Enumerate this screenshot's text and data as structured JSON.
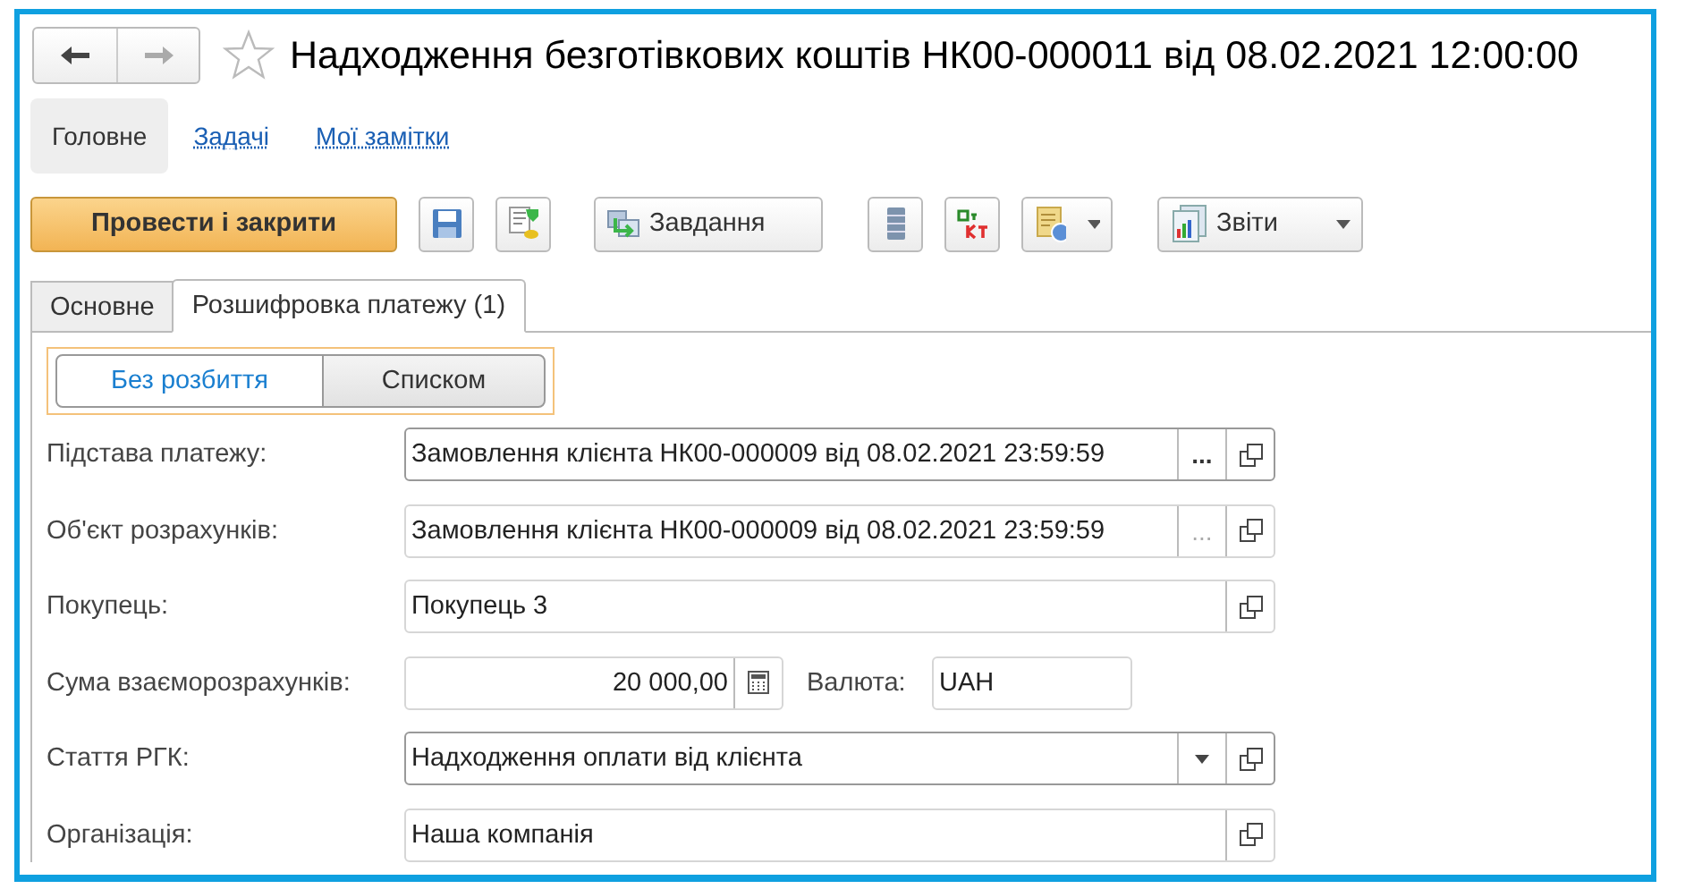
{
  "window": {
    "title": "Надходження безготівкових коштів НК00-000011 від 08.02.2021 12:00:00",
    "starred": false
  },
  "nav": [
    {
      "label": "Головне",
      "selected": true
    },
    {
      "label": "Задачі",
      "selected": false
    },
    {
      "label": "Мої замітки",
      "selected": false
    }
  ],
  "toolbar": [
    {
      "kind": "primary",
      "label": "Провести і закрити"
    },
    {
      "kind": "icon"
    },
    {
      "kind": "icon"
    },
    {
      "kind": "text",
      "label": "Завдання"
    },
    {
      "kind": "icon"
    },
    {
      "kind": "icon"
    },
    {
      "kind": "menu"
    },
    {
      "kind": "menu",
      "label": "Звіти"
    }
  ],
  "tabs": [
    {
      "label": "Основне",
      "selected": false
    },
    {
      "label": "Розшифровка платежу (1)",
      "selected": true
    }
  ],
  "split_mode": [
    {
      "label": "Без розбиття",
      "selected": true
    },
    {
      "label": "Списком",
      "selected": false
    }
  ],
  "fields": [
    {
      "kind": "choice",
      "label": "Підстава платежу:",
      "value": "Замовлення клієнта НК00-000009 від 08.02.2021 23:59:59",
      "readonly": false,
      "button": "..."
    },
    {
      "kind": "choice",
      "label": "Об'єкт розрахунків:",
      "value": "Замовлення клієнта НК00-000009 від 08.02.2021 23:59:59",
      "readonly": true,
      "button": "..."
    },
    {
      "kind": "plain",
      "label": "Покупець:",
      "value": "Покупець 3",
      "readonly": true
    },
    {
      "kind": "amount",
      "label": "Сума взаєморозрахунків:",
      "value": "20 000,00",
      "readonly": true,
      "currency_label": "Валюта:",
      "currency": "UAH"
    },
    {
      "kind": "select",
      "label": "Стаття РГК:",
      "value": "Надходження оплати від клієнта",
      "readonly": false
    },
    {
      "kind": "plain",
      "label": "Організація:",
      "value": "Наша компанія",
      "readonly": true
    }
  ]
}
